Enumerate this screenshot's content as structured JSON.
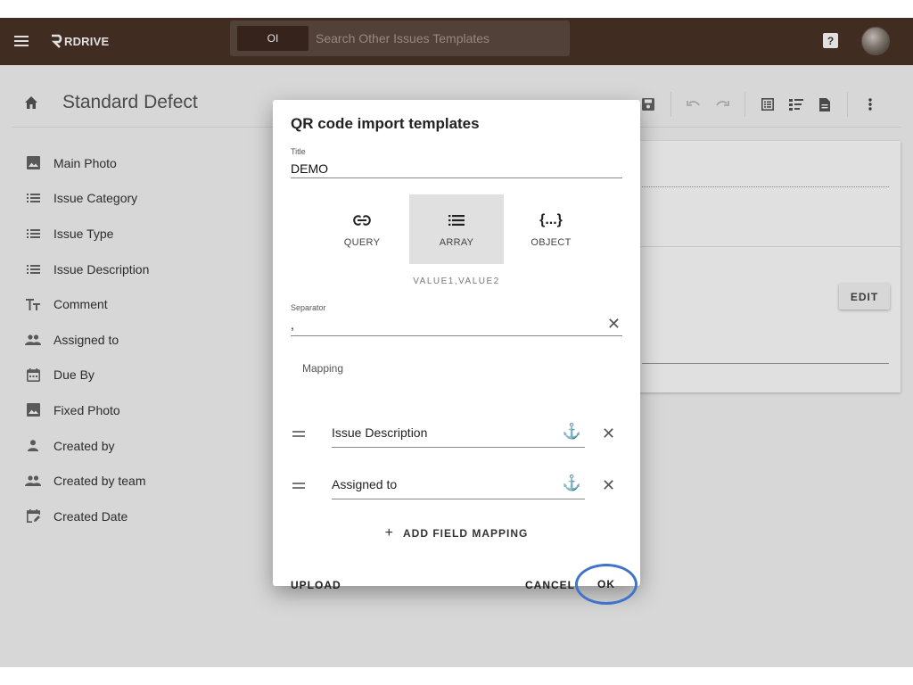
{
  "header": {
    "logo": "RDRIVE",
    "search_chip": "OI",
    "search_placeholder": "Search Other Issues Templates",
    "help_label": "?"
  },
  "page": {
    "title": "Standard Defect",
    "fields": [
      {
        "label": "Main Photo",
        "icon": "image-icon"
      },
      {
        "label": "Issue Category",
        "icon": "list-icon"
      },
      {
        "label": "Issue Type",
        "icon": "list-icon"
      },
      {
        "label": "Issue Description",
        "icon": "list-icon"
      },
      {
        "label": "Comment",
        "icon": "text-icon"
      },
      {
        "label": "Assigned to",
        "icon": "people-icon"
      },
      {
        "label": "Due By",
        "icon": "calendar-icon"
      },
      {
        "label": "Fixed Photo",
        "icon": "image-icon"
      },
      {
        "label": "Created by",
        "icon": "person-icon"
      },
      {
        "label": "Created by team",
        "icon": "people-icon"
      },
      {
        "label": "Created Date",
        "icon": "calendar-edit-icon"
      }
    ],
    "card": {
      "edit_label": "EDIT"
    }
  },
  "dialog": {
    "title": "QR code import templates",
    "title_field_label": "Title",
    "title_value": "DEMO",
    "formats": [
      {
        "label": "QUERY",
        "icon": "link-icon",
        "selected": false
      },
      {
        "label": "ARRAY",
        "icon": "list-icon",
        "selected": true
      },
      {
        "label": "OBJECT",
        "icon": "braces-icon",
        "selected": false
      }
    ],
    "format_example": "VALUE1,VALUE2",
    "separator_label": "Separator",
    "separator_value": ",",
    "mapping_label": "Mapping",
    "mappings": [
      {
        "field": "Issue Description"
      },
      {
        "field": "Assigned to"
      }
    ],
    "add_mapping_label": "ADD FIELD MAPPING",
    "upload_label": "UPLOAD",
    "cancel_label": "CANCEL",
    "ok_label": "OK"
  },
  "colors": {
    "topbar": "#4a3327",
    "highlight_ring": "#3f74c9"
  }
}
